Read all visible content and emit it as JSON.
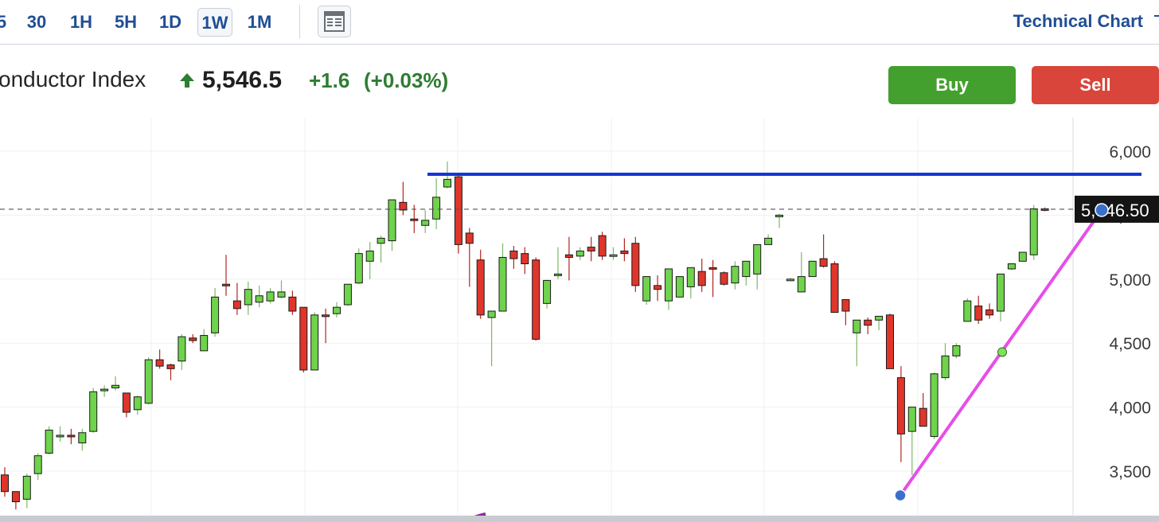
{
  "toolbar": {
    "timeframes": [
      "5",
      "30",
      "1H",
      "5H",
      "1D",
      "1W",
      "1M"
    ],
    "active_timeframe": "1W",
    "layout_icon": "table-layout-icon",
    "tech_chart_label": "Technical Chart",
    "external_icon": "external-link-icon"
  },
  "quote": {
    "name": "onductor Index",
    "arrow_icon": "up-arrow-icon",
    "last": "5,546.5",
    "change": "+1.6",
    "change_pct": "(+0.03%)"
  },
  "actions": {
    "buy_label": "Buy",
    "sell_label": "Sell"
  },
  "colors": {
    "up_candle": "#6fd34c",
    "down_candle": "#e0352b",
    "resistance_line": "#1436d6",
    "trend_line": "#e54ee8",
    "accent_blue": "#1f4e96",
    "buy": "#43a02e",
    "sell": "#d9453a"
  },
  "chart_data": {
    "type": "candlestick",
    "y_ticks": [
      "6,000",
      "5,500",
      "5,000",
      "4,500",
      "4,000",
      "3,500"
    ],
    "y_tick_values": [
      6000,
      5500,
      5000,
      4500,
      4000,
      3500
    ],
    "ylim": [
      3250,
      6200
    ],
    "current_price_label": "5,546.50",
    "current_price": 5546.5,
    "grid": true,
    "candles": [
      [
        3470,
        3530,
        3300,
        3340
      ],
      [
        3340,
        3340,
        3200,
        3260
      ],
      [
        3280,
        3480,
        3210,
        3460
      ],
      [
        3480,
        3640,
        3430,
        3620
      ],
      [
        3640,
        3850,
        3630,
        3820
      ],
      [
        3780,
        3850,
        3730,
        3780
      ],
      [
        3780,
        3830,
        3710,
        3770
      ],
      [
        3720,
        3830,
        3660,
        3800
      ],
      [
        3810,
        4150,
        3800,
        4120
      ],
      [
        4140,
        4170,
        4080,
        4140
      ],
      [
        4150,
        4240,
        4130,
        4170
      ],
      [
        4110,
        4110,
        3920,
        3960
      ],
      [
        3980,
        4090,
        3940,
        4080
      ],
      [
        4030,
        4390,
        4020,
        4370
      ],
      [
        4370,
        4450,
        4300,
        4320
      ],
      [
        4330,
        4340,
        4210,
        4300
      ],
      [
        4360,
        4570,
        4290,
        4550
      ],
      [
        4540,
        4570,
        4500,
        4520
      ],
      [
        4440,
        4610,
        4440,
        4560
      ],
      [
        4580,
        4930,
        4550,
        4860
      ],
      [
        4960,
        5190,
        4870,
        4950
      ],
      [
        4830,
        4970,
        4720,
        4770
      ],
      [
        4800,
        4980,
        4720,
        4920
      ],
      [
        4820,
        4950,
        4780,
        4870
      ],
      [
        4830,
        4930,
        4810,
        4900
      ],
      [
        4860,
        4990,
        4850,
        4900
      ],
      [
        4860,
        4910,
        4720,
        4750
      ],
      [
        4780,
        4780,
        4270,
        4290
      ],
      [
        4290,
        4740,
        4290,
        4720
      ],
      [
        4720,
        4770,
        4500,
        4710
      ],
      [
        4730,
        4820,
        4700,
        4780
      ],
      [
        4800,
        4960,
        4790,
        4960
      ],
      [
        4970,
        5240,
        4960,
        5200
      ],
      [
        5140,
        5290,
        5000,
        5220
      ],
      [
        5280,
        5340,
        5130,
        5320
      ],
      [
        5300,
        5610,
        5220,
        5620
      ],
      [
        5600,
        5760,
        5500,
        5540
      ],
      [
        5470,
        5580,
        5360,
        5460
      ],
      [
        5420,
        5540,
        5360,
        5460
      ],
      [
        5470,
        5790,
        5390,
        5640
      ],
      [
        5720,
        5920,
        5710,
        5780
      ],
      [
        5800,
        5830,
        5200,
        5270
      ],
      [
        5360,
        5400,
        4940,
        5280
      ],
      [
        5150,
        5230,
        4690,
        4720
      ],
      [
        4700,
        4730,
        4320,
        4750
      ],
      [
        4750,
        5280,
        4780,
        5170
      ],
      [
        5220,
        5260,
        5080,
        5160
      ],
      [
        5200,
        5250,
        5040,
        5120
      ],
      [
        5150,
        5170,
        4520,
        4530
      ],
      [
        4810,
        4820,
        4770,
        4990
      ],
      [
        5030,
        5250,
        5000,
        5040
      ],
      [
        5190,
        5330,
        4990,
        5170
      ],
      [
        5180,
        5250,
        5150,
        5220
      ],
      [
        5250,
        5330,
        5140,
        5220
      ],
      [
        5340,
        5370,
        5150,
        5180
      ],
      [
        5180,
        5250,
        5150,
        5190
      ],
      [
        5220,
        5320,
        5140,
        5200
      ],
      [
        5280,
        5330,
        4900,
        4950
      ],
      [
        4830,
        4970,
        4800,
        5020
      ],
      [
        4950,
        5030,
        4830,
        4920
      ],
      [
        4830,
        5050,
        4760,
        5080
      ],
      [
        4860,
        5020,
        4860,
        5020
      ],
      [
        4940,
        5080,
        4850,
        5090
      ],
      [
        5060,
        5160,
        4900,
        4950
      ],
      [
        5090,
        5150,
        4860,
        5080
      ],
      [
        5050,
        5060,
        4950,
        4960
      ],
      [
        4970,
        5140,
        4920,
        5100
      ],
      [
        5020,
        5080,
        4950,
        5140
      ],
      [
        5040,
        5270,
        4920,
        5270
      ],
      [
        5270,
        5350,
        5310,
        5320
      ],
      [
        5500,
        5510,
        5400,
        5500
      ],
      [
        5000,
        5010,
        4990,
        5000
      ],
      [
        4900,
        5210,
        4920,
        5020
      ],
      [
        5020,
        5020,
        5140,
        5140
      ],
      [
        5160,
        5350,
        5090,
        5100
      ],
      [
        5120,
        5140,
        4740,
        4740
      ],
      [
        4840,
        4840,
        4640,
        4750
      ],
      [
        4580,
        4640,
        4320,
        4680
      ],
      [
        4680,
        4700,
        4570,
        4640
      ],
      [
        4680,
        4710,
        4600,
        4710
      ],
      [
        4720,
        4730,
        4340,
        4300
      ],
      [
        4230,
        4320,
        3570,
        3790
      ],
      [
        3810,
        3910,
        3470,
        4000
      ],
      [
        3990,
        4110,
        3920,
        3850
      ],
      [
        3770,
        4270,
        3750,
        4260
      ],
      [
        4230,
        4500,
        4210,
        4400
      ],
      [
        4400,
        4500,
        4380,
        4480
      ],
      [
        4670,
        4850,
        4680,
        4830
      ],
      [
        4790,
        4870,
        4650,
        4680
      ],
      [
        4760,
        4810,
        4690,
        4720
      ],
      [
        4750,
        5000,
        4670,
        5040
      ],
      [
        5080,
        5120,
        5070,
        5120
      ],
      [
        5140,
        5180,
        5170,
        5210
      ],
      [
        5190,
        5580,
        5150,
        5550
      ],
      [
        5550,
        5560,
        5530,
        5540
      ]
    ],
    "resistance_level": 5820,
    "trend_line": {
      "start": 3310,
      "mid": 4430,
      "end": 5540
    }
  }
}
